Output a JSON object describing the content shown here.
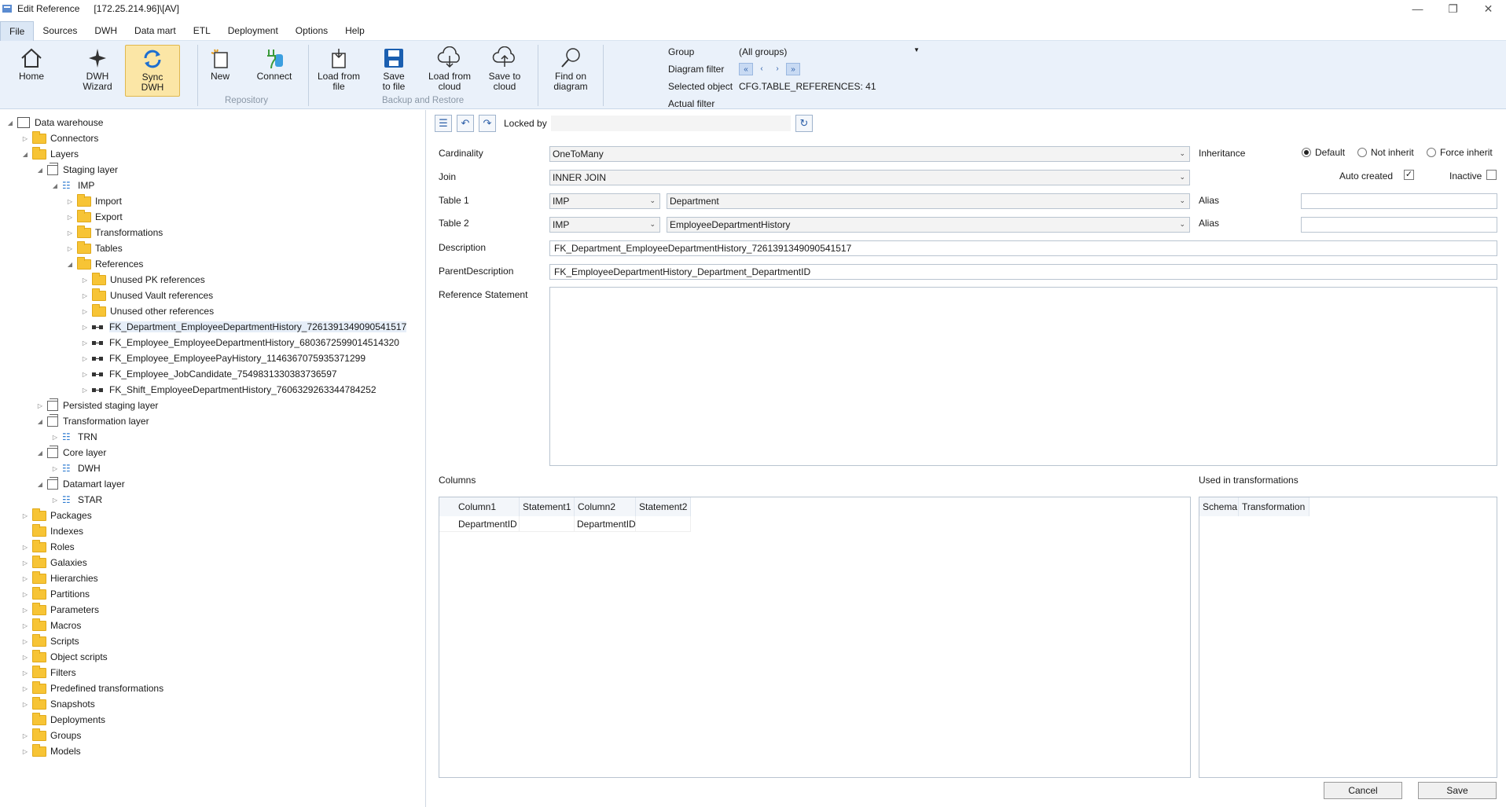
{
  "titlebar": {
    "title": "Edit Reference",
    "server": "[172.25.214.96]\\[AV]"
  },
  "menu": [
    "File",
    "Sources",
    "DWH",
    "Data mart",
    "ETL",
    "Deployment",
    "Options",
    "Help"
  ],
  "ribbon": {
    "home": "Home",
    "dwh_wizard": [
      "DWH",
      "Wizard"
    ],
    "sync_dwh": [
      "Sync",
      "DWH"
    ],
    "new": "New",
    "connect": "Connect",
    "repository_group": "Repository",
    "load_from_file": [
      "Load from",
      "file"
    ],
    "save_to_file": [
      "Save",
      "to file"
    ],
    "load_from_cloud": [
      "Load from",
      "cloud"
    ],
    "save_to_cloud": [
      "Save to",
      "cloud"
    ],
    "backup_group": "Backup and Restore",
    "find_on_diagram": [
      "Find on",
      "diagram"
    ]
  },
  "filters": {
    "group_label": "Group",
    "group_value": "(All groups)",
    "diagram_filter_label": "Diagram filter",
    "nav": [
      "«",
      "‹",
      "›",
      "»"
    ],
    "selected_object_label": "Selected object",
    "selected_object_value": "CFG.TABLE_REFERENCES: 41",
    "actual_filter_label": "Actual filter"
  },
  "tree": [
    "Data warehouse",
    "Connectors",
    "Layers",
    "Staging layer",
    "IMP",
    "Import",
    "Export",
    "Transformations",
    "Tables",
    "References",
    "Unused PK references",
    "Unused Vault references",
    "Unused other references",
    "FK_Department_EmployeeDepartmentHistory_7261391349090541517",
    "FK_Employee_EmployeeDepartmentHistory_6803672599014514320",
    "FK_Employee_EmployeePayHistory_1146367075935371299",
    "FK_Employee_JobCandidate_7549831330383736597",
    "FK_Shift_EmployeeDepartmentHistory_7606329263344784252",
    "Persisted staging layer",
    "Transformation layer",
    "TRN",
    "Core layer",
    "DWH",
    "Datamart layer",
    "STAR",
    "Packages",
    "Indexes",
    "Roles",
    "Galaxies",
    "Hierarchies",
    "Partitions",
    "Parameters",
    "Macros",
    "Scripts",
    "Object scripts",
    "Filters",
    "Predefined transformations",
    "Snapshots",
    "Deployments",
    "Groups",
    "Models"
  ],
  "form": {
    "locked_by_label": "Locked by",
    "cardinality_label": "Cardinality",
    "cardinality_value": "OneToMany",
    "join_label": "Join",
    "join_value": "INNER JOIN",
    "table1_label": "Table 1",
    "table1_schema": "IMP",
    "table1_table": "Department",
    "table2_label": "Table 2",
    "table2_schema": "IMP",
    "table2_table": "EmployeeDepartmentHistory",
    "alias_label": "Alias",
    "description_label": "Description",
    "description_value": "FK_Department_EmployeeDepartmentHistory_7261391349090541517",
    "parent_description_label": "ParentDescription",
    "parent_description_value": "FK_EmployeeDepartmentHistory_Department_DepartmentID",
    "reference_statement_label": "Reference Statement",
    "inheritance_label": "Inheritance",
    "inherit_options": [
      "Default",
      "Not inherit",
      "Force inherit"
    ],
    "auto_created_label": "Auto created",
    "inactive_label": "Inactive",
    "check_mark": "✓"
  },
  "columns": {
    "label": "Columns",
    "headers": [
      "Column1",
      "Statement1",
      "Column2",
      "Statement2"
    ],
    "rows": [
      [
        "DepartmentID",
        "",
        "DepartmentID",
        ""
      ]
    ]
  },
  "used": {
    "label": "Used in transformations",
    "headers": [
      "Schema",
      "Transformation"
    ]
  },
  "buttons": {
    "cancel": "Cancel",
    "save": "Save"
  }
}
